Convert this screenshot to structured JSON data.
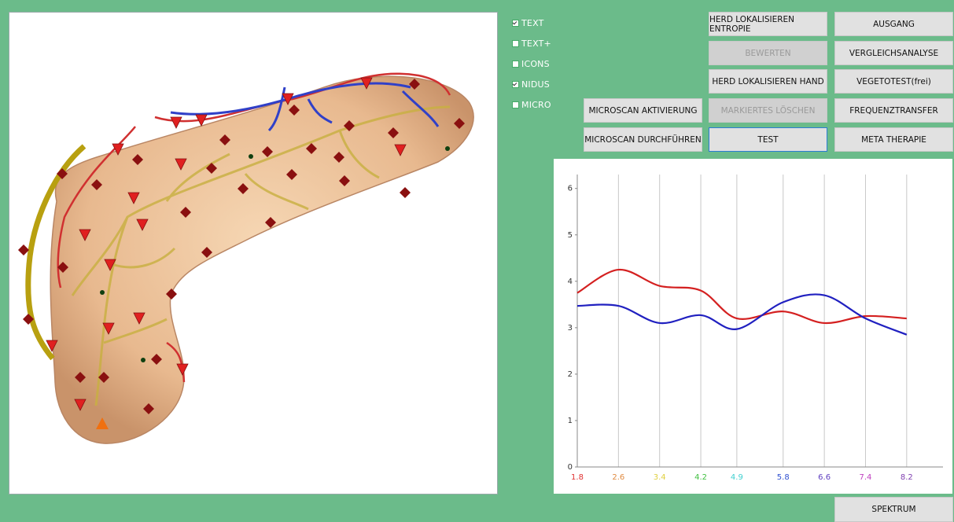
{
  "checkboxes": [
    {
      "label": "TEXT",
      "checked": true
    },
    {
      "label": "TEXT+",
      "checked": false
    },
    {
      "label": "ICONS",
      "checked": false
    },
    {
      "label": "NIDUS",
      "checked": true
    },
    {
      "label": "MICRO",
      "checked": false
    }
  ],
  "buttons": {
    "herd_entropie": "HERD LOKALISIEREN ENTROPIE",
    "ausgang": "AUSGANG",
    "bewerten": "BEWERTEN",
    "vergleichsanalyse": "VERGLEICHSANALYSE",
    "herd_hand": "HERD LOKALISIEREN HAND",
    "vegetotest": "VEGETOTEST(frei)",
    "microscan_aktivierung": "MICROSCAN AKTIVIERUNG",
    "markiertes_loeschen": "MARKIERTES LÖSCHEN",
    "frequenztransfer": "FREQUENZTRANSFER",
    "microscan_durchfuehren": "MICROSCAN DURCHFÜHREN",
    "test": "TEST",
    "meta_therapie": "META THERAPIE",
    "spektrum": "SPEKTRUM"
  },
  "chart_data": {
    "type": "line",
    "x": [
      1.8,
      2.6,
      3.4,
      4.2,
      4.9,
      5.8,
      6.6,
      7.4,
      8.2
    ],
    "x_tick_colors": [
      "#e03030",
      "#e08a40",
      "#e0d040",
      "#40c040",
      "#40d0d0",
      "#3050d0",
      "#6040c0",
      "#c040c0",
      "#8040b0"
    ],
    "y_ticks": [
      0,
      1,
      2,
      3,
      4,
      5,
      6
    ],
    "ylim": [
      0,
      6.3
    ],
    "xlim": [
      1.8,
      8.6
    ],
    "grid": "vertical",
    "series": [
      {
        "color": "#d42020",
        "values": [
          3.75,
          4.25,
          3.9,
          3.8,
          3.2,
          3.35,
          3.1,
          3.25,
          3.2
        ]
      },
      {
        "color": "#2020c0",
        "values": [
          3.47,
          3.47,
          3.1,
          3.27,
          2.97,
          3.55,
          3.7,
          3.2,
          2.85
        ]
      }
    ]
  }
}
